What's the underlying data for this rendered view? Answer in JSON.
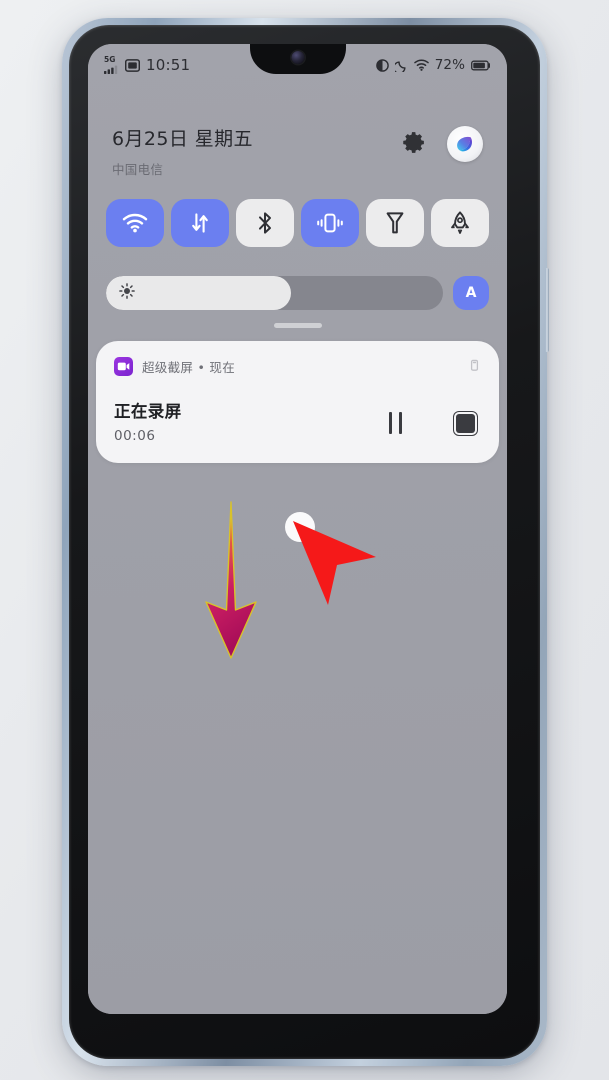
{
  "device": {
    "name": "android-phone",
    "frame_color": "#a8b8c9",
    "bezel_color": "#0d0e10",
    "screen_bg": "#9fa0a8"
  },
  "status_bar": {
    "network_label": "5G",
    "signal_icon": "cellular-signal-icon",
    "sim_icon": "sim-card-icon",
    "clock": "10:51",
    "right_icons": [
      {
        "name": "eye-protect-icon",
        "label": "eye-comfort"
      },
      {
        "name": "moon-icon",
        "label": "do-not-disturb"
      },
      {
        "name": "wifi-icon",
        "label": "wifi"
      }
    ],
    "battery_percent": "72%",
    "battery_icon": "battery-icon"
  },
  "panel_header": {
    "date": "6月25日 星期五",
    "carrier": "中国电信",
    "settings_icon": "gear-icon",
    "avatar_icon": "theme-avatar-icon"
  },
  "quick_settings": {
    "tiles": [
      {
        "name": "wifi-toggle",
        "icon": "wifi-icon",
        "active": true
      },
      {
        "name": "mobile-data-toggle",
        "icon": "data-arrows-icon",
        "active": true
      },
      {
        "name": "bluetooth-toggle",
        "icon": "bluetooth-icon",
        "active": false
      },
      {
        "name": "vibrate-toggle",
        "icon": "vibrate-icon",
        "active": true
      },
      {
        "name": "flashlight-toggle",
        "icon": "flashlight-icon",
        "active": false
      },
      {
        "name": "boost-toggle",
        "icon": "rocket-icon",
        "active": false
      }
    ],
    "active_color": "#6b7ff0",
    "inactive_color": "#ececed"
  },
  "brightness": {
    "icon": "brightness-sun-icon",
    "level_percent": 55,
    "auto_label": "A",
    "auto_active": true
  },
  "notification": {
    "app_icon": "screen-recorder-icon",
    "source_text": "超级截屏 • 现在",
    "app_name": "超级截屏",
    "time_text": "现在",
    "expand_icon": "chevron-down-icon",
    "title": "正在录屏",
    "timer": "00:06",
    "pause_icon": "pause-icon",
    "stop_icon": "stop-icon",
    "card_color": "#f4f4f6"
  },
  "overlays": {
    "swipe_arrow": {
      "name": "swipe-down-arrow",
      "direction": "down",
      "gradient_from": "#f2d23a",
      "gradient_to": "#b5135e"
    },
    "cursor": {
      "name": "mouse-cursor",
      "color": "#f51919",
      "touch_ring_color": "#ffffff"
    }
  }
}
